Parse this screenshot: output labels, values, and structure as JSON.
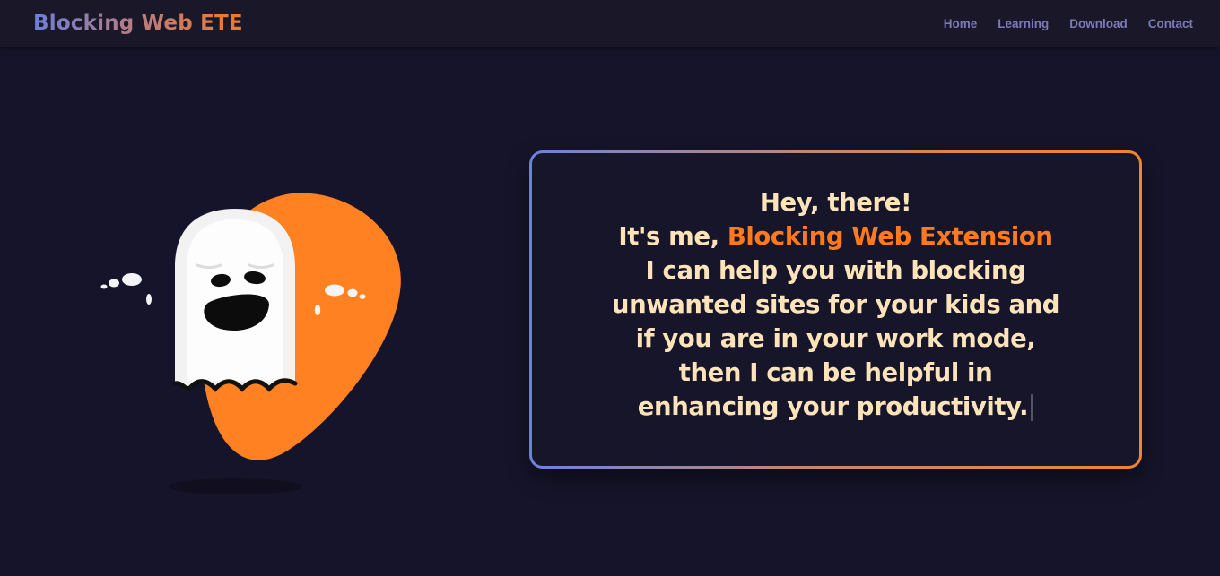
{
  "navbar": {
    "brand": "Blocking Web ETE",
    "links": [
      "Home",
      "Learning",
      "Download",
      "Contact"
    ]
  },
  "intro": {
    "line1": "Hey, there!",
    "line2_prefix": "It's me, ",
    "line2_highlight": "Blocking Web Extension",
    "line3": "I can help you with blocking",
    "line4": "unwanted sites for your kids and",
    "line5": "if you are in your work mode,",
    "line6": "then I can be helpful in",
    "line7": "enhancing your productivity."
  },
  "colors": {
    "background": "#16142a",
    "accent_orange": "#ff7a1f",
    "text_cream": "#fde3b9",
    "nav_link": "#7b7ab8",
    "gradient_start": "#6b82e0",
    "gradient_end": "#f3842a"
  },
  "icons": {
    "hero": "ghost-illustration",
    "cursor": "text-caret"
  }
}
